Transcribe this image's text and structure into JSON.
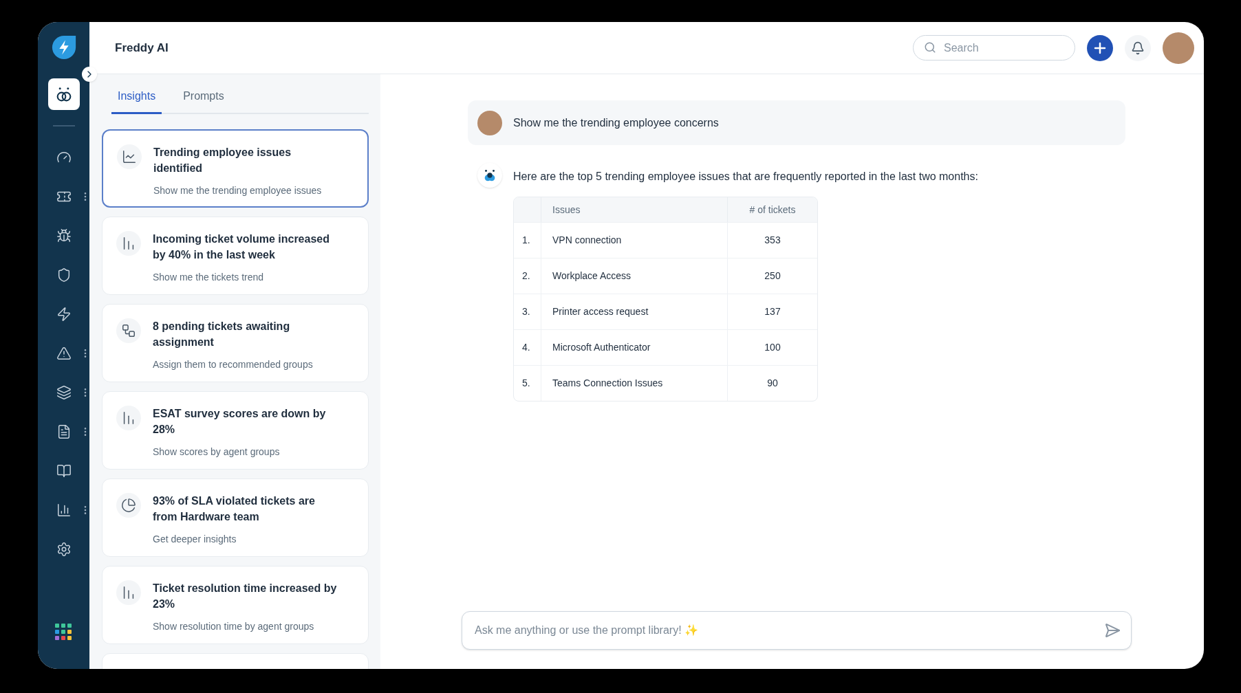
{
  "header": {
    "title": "Freddy AI",
    "search": {
      "placeholder": "Search"
    }
  },
  "sidebar": {
    "items": [
      {
        "kind": "freddy",
        "selected": true,
        "has_menu": false
      },
      {
        "kind": "dashboard",
        "selected": false,
        "has_menu": false
      },
      {
        "kind": "tickets",
        "selected": false,
        "has_menu": true
      },
      {
        "kind": "problems",
        "selected": false,
        "has_menu": false
      },
      {
        "kind": "changes",
        "selected": false,
        "has_menu": false
      },
      {
        "kind": "releases",
        "selected": false,
        "has_menu": false
      },
      {
        "kind": "alerts",
        "selected": false,
        "has_menu": true
      },
      {
        "kind": "assets",
        "selected": false,
        "has_menu": true
      },
      {
        "kind": "contracts",
        "selected": false,
        "has_menu": true
      },
      {
        "kind": "solutions",
        "selected": false,
        "has_menu": false
      },
      {
        "kind": "reports",
        "selected": false,
        "has_menu": true
      },
      {
        "kind": "admin",
        "selected": false,
        "has_menu": false
      }
    ]
  },
  "tabs": [
    {
      "label": "Insights",
      "selected": true
    },
    {
      "label": "Prompts",
      "selected": false
    }
  ],
  "insights": [
    {
      "kind": "trend",
      "title": "Trending employee issues identified",
      "action": "Show me the trending employee issues",
      "selected": true
    },
    {
      "kind": "volume",
      "title": "Incoming ticket volume increased by 40% in the last week",
      "action": "Show me the tickets trend",
      "selected": false
    },
    {
      "kind": "assign",
      "title": "8 pending tickets awaiting assignment",
      "action": "Assign them to recommended groups",
      "selected": false
    },
    {
      "kind": "decline",
      "title": "ESAT survey scores are down by 28%",
      "action": "Show scores by agent groups",
      "selected": false
    },
    {
      "kind": "pie",
      "title": "93% of SLA violated tickets are from Hardware team",
      "action": "Get deeper insights",
      "selected": false
    },
    {
      "kind": "volume",
      "title": "Ticket resolution time increased by 23%",
      "action": "Show resolution time by agent groups",
      "selected": false
    }
  ],
  "chat": {
    "messages": [
      {
        "kind": "user",
        "text": "Show me the trending employee concerns"
      },
      {
        "kind": "bot",
        "text": "Here are the top 5 trending employee issues that are frequently reported in the last two months:",
        "table": {
          "columns": [
            "Issues",
            "# of tickets"
          ],
          "rows": [
            {
              "number": "1.",
              "issue": "VPN connection",
              "tickets": "353"
            },
            {
              "number": "2.",
              "issue": "Workplace Access",
              "tickets": "250"
            },
            {
              "number": "3.",
              "issue": "Printer access request",
              "tickets": "137"
            },
            {
              "number": "4.",
              "issue": "Microsoft Authenticator",
              "tickets": "100"
            },
            {
              "number": "5.",
              "issue": "Teams Connection Issues",
              "tickets": "90"
            }
          ]
        }
      }
    ]
  },
  "input": {
    "placeholder": "Ask me anything or use the prompt library! ✨"
  }
}
